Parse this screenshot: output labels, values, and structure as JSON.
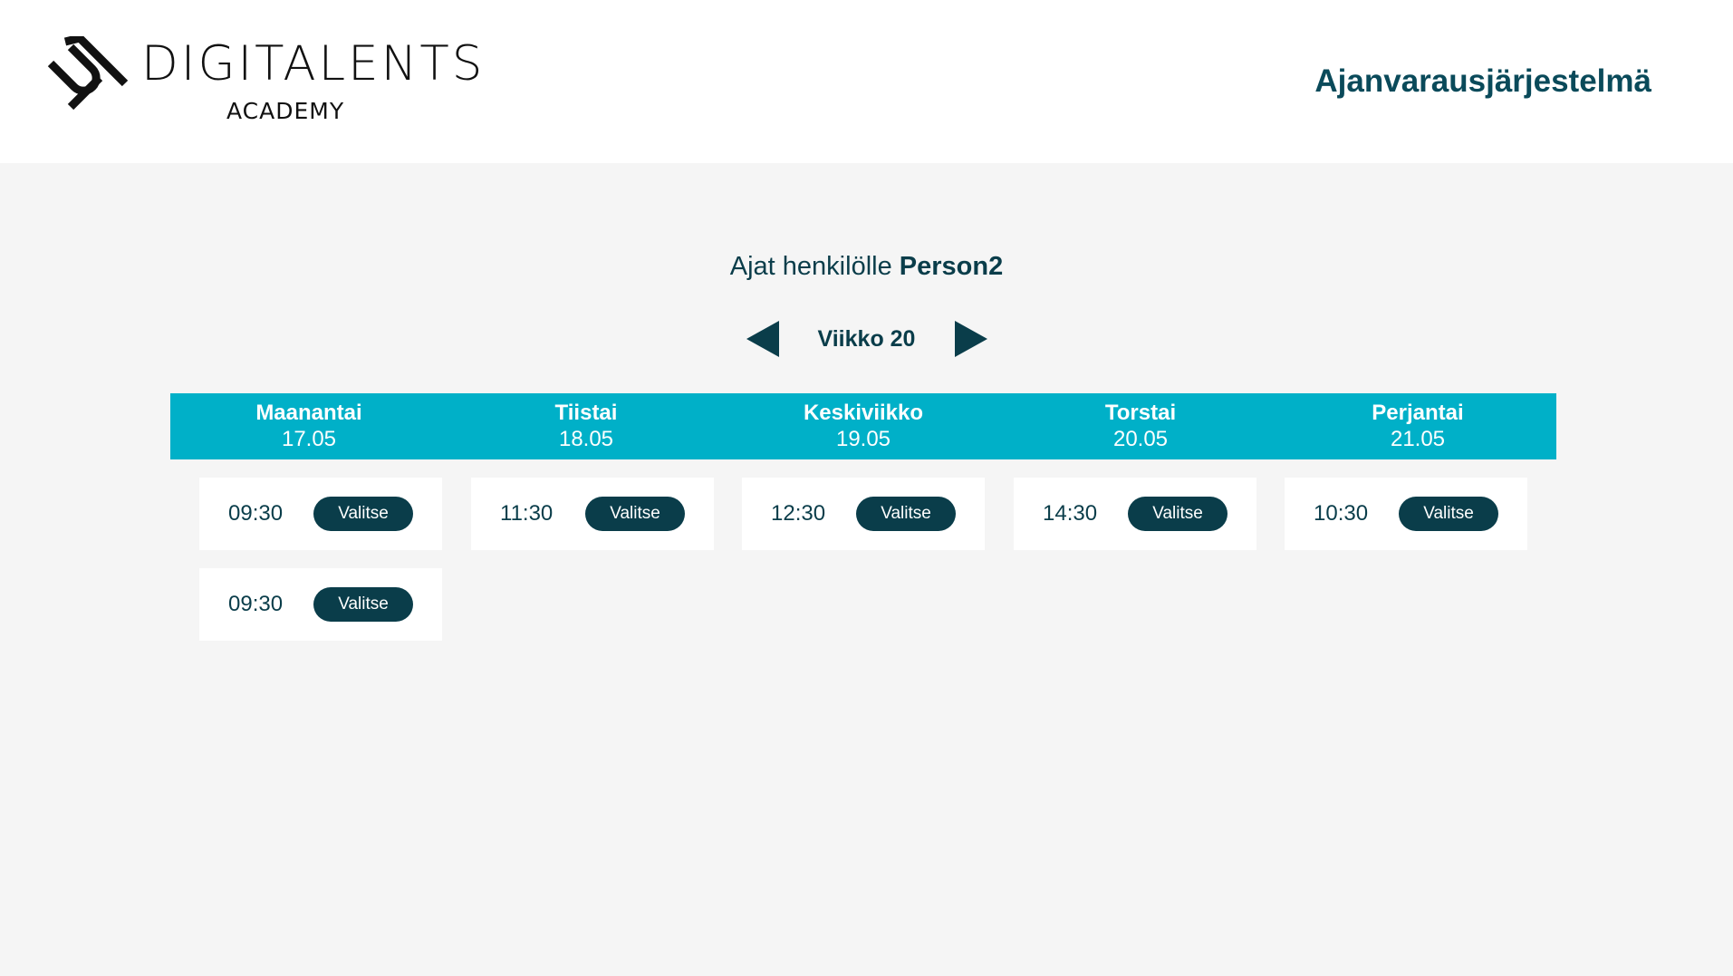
{
  "header": {
    "logo_text": "DIGITALENTS",
    "logo_subtext": "ACADEMY",
    "app_title": "Ajanvarausjärjestelmä"
  },
  "person": {
    "prefix": "Ajat henkilölle ",
    "name": "Person2"
  },
  "week_nav": {
    "label": "Viikko 20",
    "prev_icon": "triangle-left-icon",
    "next_icon": "triangle-right-icon"
  },
  "days": [
    {
      "name": "Maanantai",
      "date": "17.05"
    },
    {
      "name": "Tiistai",
      "date": "18.05"
    },
    {
      "name": "Keskiviikko",
      "date": "19.05"
    },
    {
      "name": "Torstai",
      "date": "20.05"
    },
    {
      "name": "Perjantai",
      "date": "21.05"
    }
  ],
  "slots": [
    {
      "time": "09:30",
      "button": "Valitse"
    },
    {
      "time": "11:30",
      "button": "Valitse"
    },
    {
      "time": "12:30",
      "button": "Valitse"
    },
    {
      "time": "14:30",
      "button": "Valitse"
    },
    {
      "time": "10:30",
      "button": "Valitse"
    },
    {
      "time": "09:30",
      "button": "Valitse"
    }
  ],
  "colors": {
    "primary": "#0a3d4a",
    "accent": "#00b0c8",
    "background": "#f5f5f5"
  }
}
